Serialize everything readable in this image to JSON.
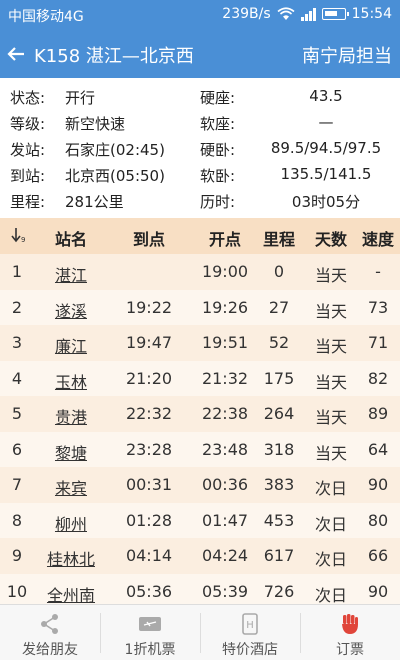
{
  "status_bar": {
    "carrier": "中国移动4G",
    "speed": "239B/s",
    "time": "15:54"
  },
  "header": {
    "title": "K158 湛江—北京西",
    "right": "南宁局担当"
  },
  "info": [
    {
      "k1": "状态:",
      "v1": "开行",
      "k2": "硬座:",
      "v2": "43.5"
    },
    {
      "k1": "等级:",
      "v1": "新空快速",
      "k2": "软座:",
      "v2": "—"
    },
    {
      "k1": "发站:",
      "v1": "石家庄(02:45)",
      "k2": "硬卧:",
      "v2": "89.5/94.5/97.5"
    },
    {
      "k1": "到站:",
      "v1": "北京西(05:50)",
      "k2": "软卧:",
      "v2": "135.5/141.5"
    },
    {
      "k1": "里程:",
      "v1": "281公里",
      "k2": "历时:",
      "v2": "03时05分"
    }
  ],
  "table": {
    "headers": [
      "站名",
      "到点",
      "开点",
      "里程",
      "天数",
      "速度"
    ],
    "rows": [
      [
        "1",
        "湛江",
        "",
        "19:00",
        "0",
        "当天",
        "-"
      ],
      [
        "2",
        "遂溪",
        "19:22",
        "19:26",
        "27",
        "当天",
        "73"
      ],
      [
        "3",
        "廉江",
        "19:47",
        "19:51",
        "52",
        "当天",
        "71"
      ],
      [
        "4",
        "玉林",
        "21:20",
        "21:32",
        "175",
        "当天",
        "82"
      ],
      [
        "5",
        "贵港",
        "22:32",
        "22:38",
        "264",
        "当天",
        "89"
      ],
      [
        "6",
        "黎塘",
        "23:28",
        "23:48",
        "318",
        "当天",
        "64"
      ],
      [
        "7",
        "来宾",
        "00:31",
        "00:36",
        "383",
        "次日",
        "90"
      ],
      [
        "8",
        "柳州",
        "01:28",
        "01:47",
        "453",
        "次日",
        "80"
      ],
      [
        "9",
        "桂林北",
        "04:14",
        "04:24",
        "617",
        "次日",
        "66"
      ],
      [
        "10",
        "全州南",
        "05:36",
        "05:39",
        "726",
        "次日",
        "90"
      ]
    ]
  },
  "tabs": [
    {
      "label": "发给朋友",
      "icon": "share-icon"
    },
    {
      "label": "1折机票",
      "icon": "plane-ticket-icon"
    },
    {
      "label": "特价酒店",
      "icon": "hotel-icon"
    },
    {
      "label": "订票",
      "icon": "fist-icon"
    }
  ],
  "colors": {
    "primary": "#4a8fd6",
    "table_header": "#f8dfc4",
    "row_odd": "#fbeee0",
    "row_even": "#fdf6ee",
    "accent_red": "#e0453a"
  }
}
